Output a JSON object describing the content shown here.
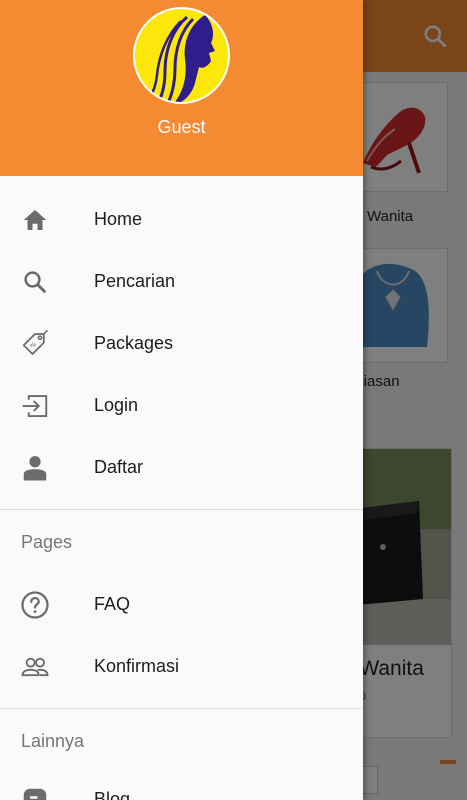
{
  "background": {
    "card_captions": [
      "atu Wanita",
      "erhiasan"
    ],
    "product_title": "s Wanita",
    "product_subtitle": "arjo"
  },
  "drawer": {
    "user_name": "Guest",
    "main_items": [
      {
        "label": "Home",
        "icon": "home-icon"
      },
      {
        "label": "Pencarian",
        "icon": "search-icon"
      },
      {
        "label": "Packages",
        "icon": "tag-icon"
      },
      {
        "label": "Login",
        "icon": "login-icon"
      },
      {
        "label": "Daftar",
        "icon": "person-icon"
      }
    ],
    "pages_label": "Pages",
    "pages_items": [
      {
        "label": "FAQ",
        "icon": "help-icon"
      },
      {
        "label": "Konfirmasi",
        "icon": "people-icon"
      }
    ],
    "others_label": "Lainnya",
    "others_items": [
      {
        "label": "Blog",
        "icon": "blog-icon"
      }
    ]
  },
  "colors": {
    "accent": "#f48a32",
    "avatar_bg": "#fbe80a",
    "avatar_fg": "#2e1d8a"
  }
}
